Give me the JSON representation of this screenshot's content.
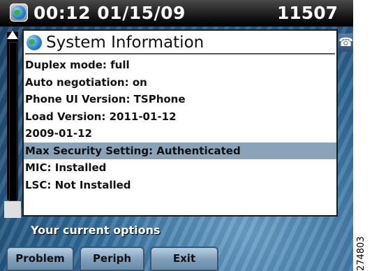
{
  "status": {
    "clock": "00:12 01/15/09",
    "extension": "11507"
  },
  "dialog": {
    "title": "System Information",
    "rows": [
      "Duplex mode: full",
      "Auto negotiation: on",
      "Phone UI Version: TSPhone",
      "Load Version: 2011-01-12",
      "2009-01-12",
      "Max Security Setting: Authenticated",
      "MIC: Installed",
      "LSC: Not Installed"
    ],
    "selected_index": 5
  },
  "options_label": "Your current options",
  "softkeys": [
    "Problem",
    "Periph",
    "Exit"
  ],
  "figure_id": "274803",
  "colors": {
    "selected_row": "#8aa3b8",
    "status_bar": "#000000",
    "softkey": "#8fb0cc"
  },
  "icons": [
    "globe-icon",
    "scroll-up-arrow-icon",
    "phone-line-icon"
  ]
}
